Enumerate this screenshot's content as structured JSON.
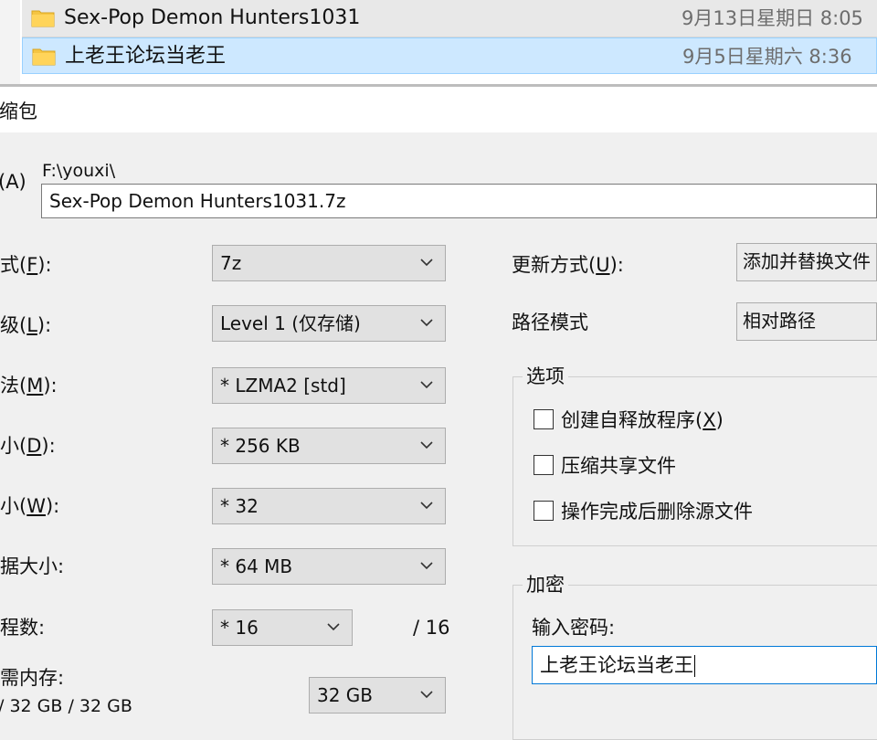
{
  "files": [
    {
      "name": "Sex-Pop Demon Hunters1031",
      "date": "9月13日星期日 8:05"
    },
    {
      "name": "上老王论坛当老王",
      "date": "9月5日星期六 8:36"
    }
  ],
  "dialog": {
    "title": "压缩包",
    "archive_label": "(A)",
    "path": "F:\\youxi\\",
    "archive_name": "Sex-Pop Demon Hunters1031.7z"
  },
  "settings": {
    "format_label": "式(",
    "format_key": "F",
    "format_value": "7z",
    "level_label": "级(",
    "level_key": "L",
    "level_value": "Level 1 (仅存储)",
    "method_label": "法(",
    "method_key": "M",
    "method_value": "* LZMA2 [std]",
    "dict_label": "小(",
    "dict_key": "D",
    "dict_value": "* 256 KB",
    "word_label": "小(",
    "word_key": "W",
    "word_value": "* 32",
    "solid_label": "据大小:",
    "solid_value": "* 64 MB",
    "threads_label": "程数:",
    "threads_value": "* 16",
    "threads_max": "/ 16",
    "memory_label": "需内存:",
    "memory_info": "/ 32 GB / 32 GB",
    "memory_value": "32 GB",
    "label_suffix": "):"
  },
  "right": {
    "update_label": "更新方式(",
    "update_key": "U",
    "update_value": "添加并替换文件",
    "path_mode_label": "路径模式",
    "path_mode_value": "相对路径",
    "options_title": "选项",
    "options": [
      {
        "label": "创建自释放程序(",
        "key": "X",
        "suffix": ")"
      },
      {
        "label": "压缩共享文件",
        "key": "",
        "suffix": ""
      },
      {
        "label": "操作完成后删除源文件",
        "key": "",
        "suffix": ""
      }
    ],
    "encrypt_title": "加密",
    "password_label": "输入密码:",
    "password_value": "上老王论坛当老王"
  },
  "colors": {
    "selection_bg": "#cde8ff",
    "selection_border": "#99d1ff",
    "folder": "#f5c542",
    "focus": "#0078d7"
  }
}
